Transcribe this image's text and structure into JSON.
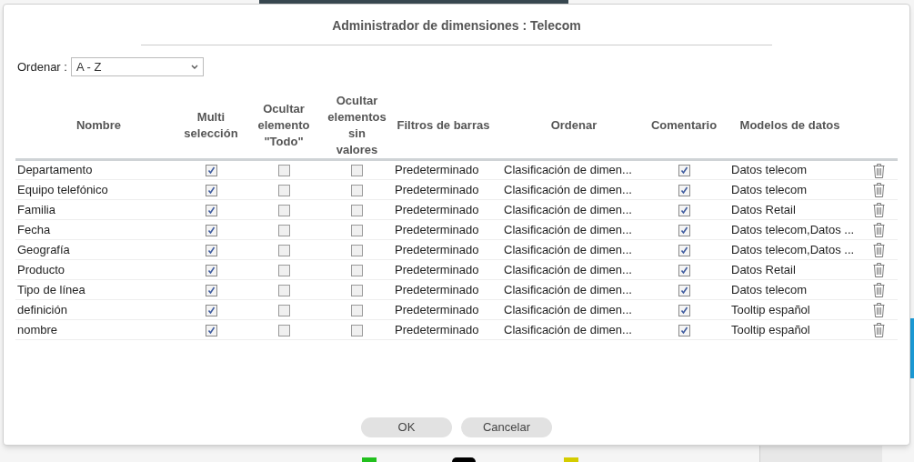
{
  "dialog": {
    "title": "Administrador de dimensiones : Telecom",
    "sort": {
      "label": "Ordenar :",
      "value": "A - Z"
    },
    "columns": [
      "Nombre",
      "Multi selección",
      "Ocultar elemento \"Todo\"",
      "Ocultar elementos sin valores",
      "Filtros de barras",
      "Ordenar",
      "Comentario",
      "Modelos de datos"
    ],
    "rows": [
      {
        "name": "Departamento",
        "multi": true,
        "hide_all": false,
        "hide_empty": false,
        "filter": "Predeterminado",
        "order": "Clasificación de dimen...",
        "comment": true,
        "models": "Datos telecom"
      },
      {
        "name": "Equipo telefónico",
        "multi": true,
        "hide_all": false,
        "hide_empty": false,
        "filter": "Predeterminado",
        "order": "Clasificación de dimen...",
        "comment": true,
        "models": "Datos telecom"
      },
      {
        "name": "Familia",
        "multi": true,
        "hide_all": false,
        "hide_empty": false,
        "filter": "Predeterminado",
        "order": "Clasificación de dimen...",
        "comment": true,
        "models": "Datos Retail"
      },
      {
        "name": "Fecha",
        "multi": true,
        "hide_all": false,
        "hide_empty": false,
        "filter": "Predeterminado",
        "order": "Clasificación de dimen...",
        "comment": true,
        "models": "Datos telecom,Datos ..."
      },
      {
        "name": "Geografía",
        "multi": true,
        "hide_all": false,
        "hide_empty": false,
        "filter": "Predeterminado",
        "order": "Clasificación de dimen...",
        "comment": true,
        "models": "Datos telecom,Datos ..."
      },
      {
        "name": "Producto",
        "multi": true,
        "hide_all": false,
        "hide_empty": false,
        "filter": "Predeterminado",
        "order": "Clasificación de dimen...",
        "comment": true,
        "models": "Datos Retail"
      },
      {
        "name": "Tipo de línea",
        "multi": true,
        "hide_all": false,
        "hide_empty": false,
        "filter": "Predeterminado",
        "order": "Clasificación de dimen...",
        "comment": true,
        "models": "Datos telecom"
      },
      {
        "name": "definición",
        "multi": true,
        "hide_all": false,
        "hide_empty": false,
        "filter": "Predeterminado",
        "order": "Clasificación de dimen...",
        "comment": true,
        "models": "Tooltip español"
      },
      {
        "name": "nombre",
        "multi": true,
        "hide_all": false,
        "hide_empty": false,
        "filter": "Predeterminado",
        "order": "Clasificación de dimen...",
        "comment": true,
        "models": "Tooltip español"
      }
    ],
    "buttons": [
      "OK",
      "Cancelar"
    ]
  }
}
